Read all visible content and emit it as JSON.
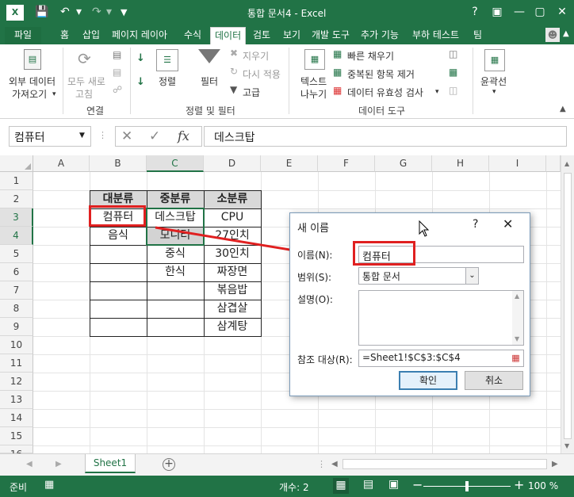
{
  "window": {
    "title": "통합 문서4 - Excel",
    "app_logo": "X",
    "help_label": "?",
    "user_icon": "user-icon"
  },
  "ribbon_tabs": [
    "파일",
    "홈",
    "삽입",
    "페이지 레이아",
    "수식",
    "데이터",
    "검토",
    "보기",
    "개발 도구",
    "추가 기능",
    "부하 테스트",
    "팀"
  ],
  "ribbon": {
    "external_data": [
      "외부 데이터",
      "가져오기"
    ],
    "refresh_all": [
      "모두 새로",
      "고침"
    ],
    "connections_group": "연결",
    "sort": "정렬",
    "filter": "필터",
    "clear": "지우기",
    "reapply": "다시 적용",
    "advanced": "고급",
    "sort_filter_group": "정렬 및 필터",
    "text_to_columns": [
      "텍스트",
      "나누기"
    ],
    "flash_fill": "빠른 채우기",
    "remove_duplicates": "중복된 항목 제거",
    "data_validation": "데이터 유효성 검사",
    "data_tools_group": "데이터 도구",
    "outline": "윤곽선"
  },
  "formula_bar": {
    "name_box": "컴퓨터",
    "fx_label": "fx",
    "value": "데스크탑"
  },
  "grid": {
    "columns": [
      "A",
      "B",
      "C",
      "D",
      "E",
      "F",
      "G",
      "H",
      "I"
    ],
    "rows": [
      "1",
      "2",
      "3",
      "4",
      "5",
      "6",
      "7",
      "8",
      "9",
      "10",
      "11",
      "12",
      "13",
      "14",
      "15",
      "16"
    ],
    "headers": [
      "대분류",
      "중분류",
      "소분류"
    ],
    "col_b": [
      "컴퓨터",
      "음식"
    ],
    "col_c": [
      "데스크탑",
      "모니터",
      "중식",
      "한식"
    ],
    "col_d": [
      "CPU",
      "27인치",
      "30인치",
      "짜장면",
      "볶음밥",
      "삼겹살",
      "삼계탕"
    ]
  },
  "sheet_tabs": [
    "Sheet1"
  ],
  "status": {
    "mode": "준비",
    "count": "개수: 2",
    "zoom": "100 %"
  },
  "dialog": {
    "title": "새 이름",
    "help": "?",
    "name_label": "이름(N):",
    "name_value": "컴퓨터",
    "scope_label": "범위(S):",
    "scope_value": "통합 문서",
    "comment_label": "설명(O):",
    "refers_label": "참조 대상(R):",
    "refers_value": "=Sheet1!$C$3:$C$4",
    "ok": "확인",
    "cancel": "취소"
  },
  "colors": {
    "excel_green": "#217346",
    "annotation_red": "#e02020"
  }
}
